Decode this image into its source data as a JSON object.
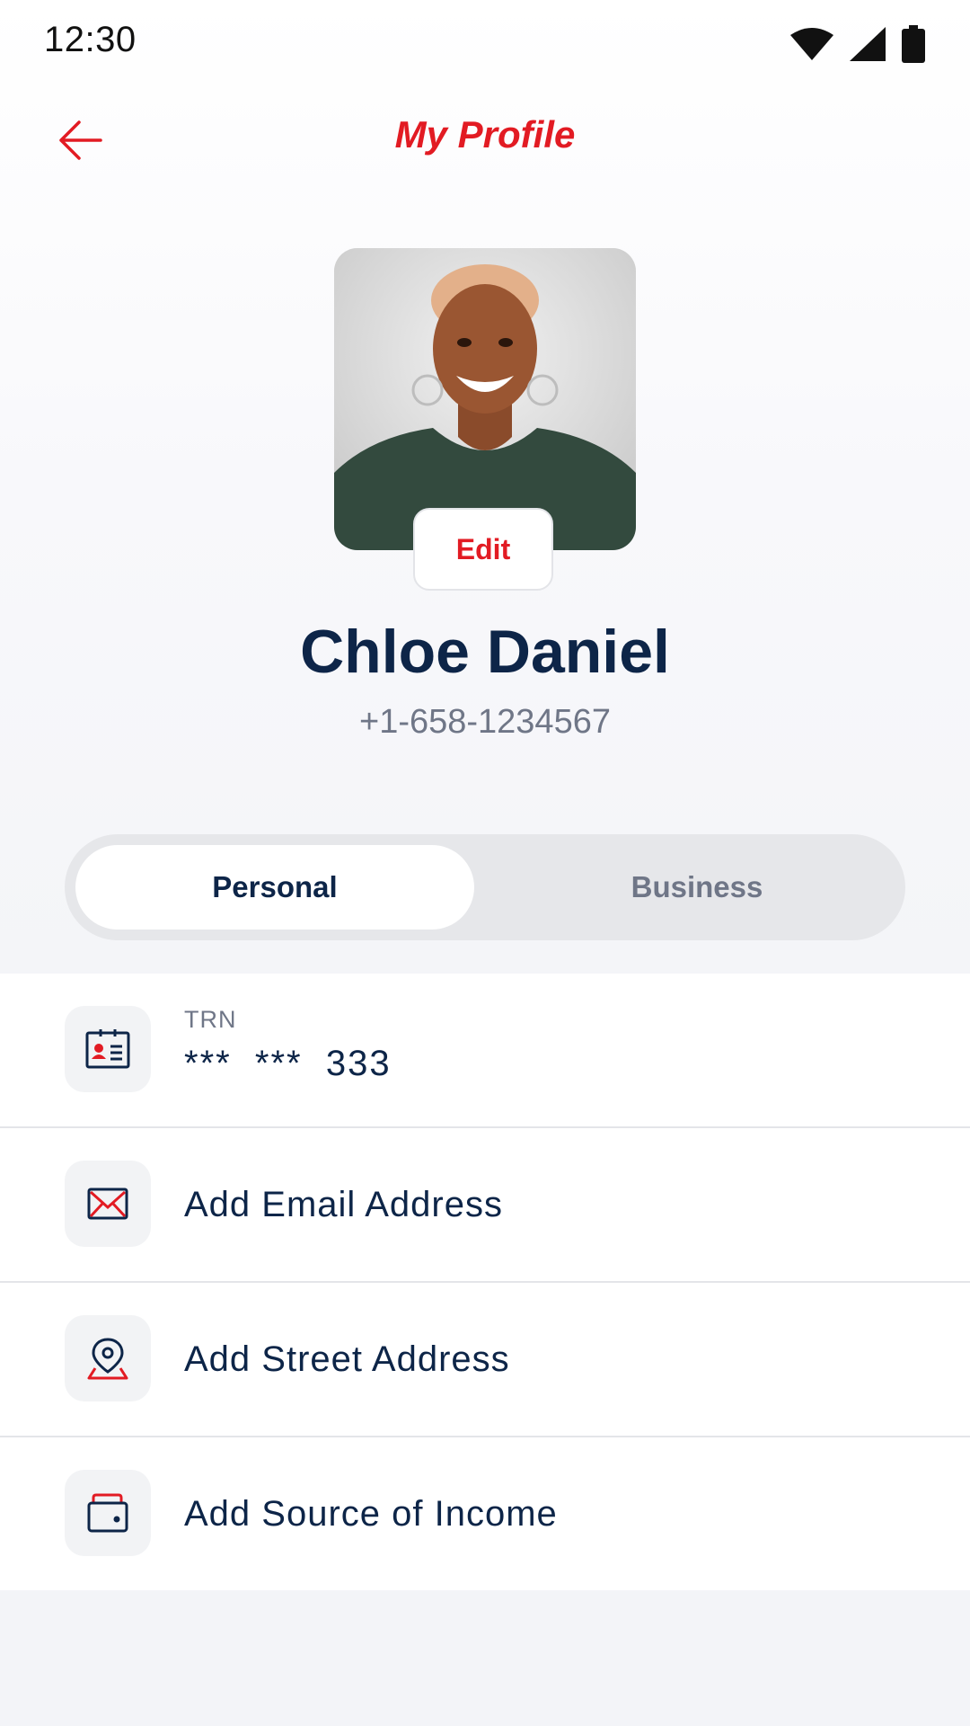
{
  "status_bar": {
    "time": "12:30",
    "icons": [
      "wifi-icon",
      "signal-icon",
      "battery-icon"
    ]
  },
  "header": {
    "back_icon": "arrow-left-icon",
    "title": "My Profile"
  },
  "profile": {
    "edit_label": "Edit",
    "name": "Chloe Daniel",
    "phone": "+1-658-1234567"
  },
  "tabs": {
    "selected": "Personal",
    "options": [
      "Personal",
      "Business"
    ]
  },
  "list": {
    "trn": {
      "label": "TRN",
      "value": "***  ***  333",
      "icon": "id-card-icon"
    },
    "items": [
      {
        "label": "Add Email Address",
        "icon": "mail-icon"
      },
      {
        "label": "Add Street Address",
        "icon": "location-pin-icon"
      },
      {
        "label": "Add Source of Income",
        "icon": "wallet-icon"
      }
    ]
  },
  "colors": {
    "brand_red": "#e21b23",
    "navy": "#0d2548",
    "muted": "#6f7687"
  }
}
